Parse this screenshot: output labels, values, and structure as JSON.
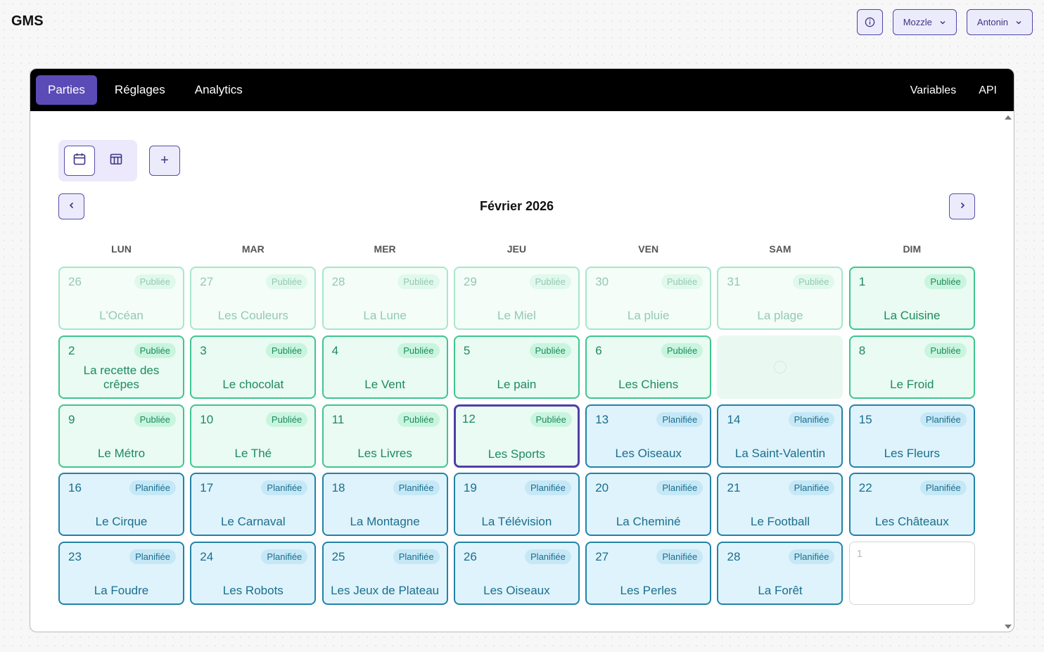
{
  "app": {
    "title": "GMS"
  },
  "topbar": {
    "info_icon": "info-icon",
    "org_selector": "Mozzle",
    "user_selector": "Antonin"
  },
  "nav": {
    "tabs": [
      "Parties",
      "Réglages",
      "Analytics"
    ],
    "active_tab": "Parties",
    "right_links": [
      "Variables",
      "API"
    ]
  },
  "toolbar": {
    "views": [
      "calendar-icon",
      "table-icon"
    ],
    "active_view": "calendar-icon",
    "add_label": "+"
  },
  "calendar": {
    "month": "Février 2026",
    "weekdays": [
      "LUN",
      "MAR",
      "MER",
      "JEU",
      "VEN",
      "SAM",
      "DIM"
    ],
    "status_colors": {
      "Publiée": "#3fc58f",
      "Planifiée": "#2283a8",
      "selected": "#4e3fa6"
    },
    "cells": [
      {
        "day": "26",
        "status": "Publiée",
        "title": "L'Océan",
        "variant": "faded"
      },
      {
        "day": "27",
        "status": "Publiée",
        "title": "Les Couleurs",
        "variant": "faded"
      },
      {
        "day": "28",
        "status": "Publiée",
        "title": "La Lune",
        "variant": "faded"
      },
      {
        "day": "29",
        "status": "Publiée",
        "title": "Le Miel",
        "variant": "faded"
      },
      {
        "day": "30",
        "status": "Publiée",
        "title": "La pluie",
        "variant": "faded"
      },
      {
        "day": "31",
        "status": "Publiée",
        "title": "La plage",
        "variant": "faded"
      },
      {
        "day": "1",
        "status": "Publiée",
        "title": "La Cuisine",
        "variant": "published"
      },
      {
        "day": "2",
        "status": "Publiée",
        "title": "La recette des crêpes",
        "variant": "published"
      },
      {
        "day": "3",
        "status": "Publiée",
        "title": "Le chocolat",
        "variant": "published"
      },
      {
        "day": "4",
        "status": "Publiée",
        "title": "Le Vent",
        "variant": "published"
      },
      {
        "day": "5",
        "status": "Publiée",
        "title": "Le pain",
        "variant": "published"
      },
      {
        "day": "6",
        "status": "Publiée",
        "title": "Les Chiens",
        "variant": "published"
      },
      {
        "day": "",
        "status": "",
        "title": "",
        "variant": "empty"
      },
      {
        "day": "8",
        "status": "Publiée",
        "title": "Le Froid",
        "variant": "published"
      },
      {
        "day": "9",
        "status": "Publiée",
        "title": "Le Métro",
        "variant": "published"
      },
      {
        "day": "10",
        "status": "Publiée",
        "title": "Le Thé",
        "variant": "published"
      },
      {
        "day": "11",
        "status": "Publiée",
        "title": "Les Livres",
        "variant": "published"
      },
      {
        "day": "12",
        "status": "Publiée",
        "title": "Les Sports",
        "variant": "selected"
      },
      {
        "day": "13",
        "status": "Planifiée",
        "title": "Les Oiseaux",
        "variant": "planned"
      },
      {
        "day": "14",
        "status": "Planifiée",
        "title": "La Saint-Valentin",
        "variant": "planned"
      },
      {
        "day": "15",
        "status": "Planifiée",
        "title": "Les Fleurs",
        "variant": "planned"
      },
      {
        "day": "16",
        "status": "Planifiée",
        "title": "Le Cirque",
        "variant": "planned"
      },
      {
        "day": "17",
        "status": "Planifiée",
        "title": "Le Carnaval",
        "variant": "planned"
      },
      {
        "day": "18",
        "status": "Planifiée",
        "title": "La Montagne",
        "variant": "planned"
      },
      {
        "day": "19",
        "status": "Planifiée",
        "title": "La Télévision",
        "variant": "planned"
      },
      {
        "day": "20",
        "status": "Planifiée",
        "title": "La Cheminé",
        "variant": "planned"
      },
      {
        "day": "21",
        "status": "Planifiée",
        "title": "Le Football",
        "variant": "planned"
      },
      {
        "day": "22",
        "status": "Planifiée",
        "title": "Les Châteaux",
        "variant": "planned"
      },
      {
        "day": "23",
        "status": "Planifiée",
        "title": "La Foudre",
        "variant": "planned"
      },
      {
        "day": "24",
        "status": "Planifiée",
        "title": "Les Robots",
        "variant": "planned"
      },
      {
        "day": "25",
        "status": "Planifiée",
        "title": "Les Jeux de Plateau",
        "variant": "planned"
      },
      {
        "day": "26",
        "status": "Planifiée",
        "title": "Les Oiseaux",
        "variant": "planned"
      },
      {
        "day": "27",
        "status": "Planifiée",
        "title": "Les Perles",
        "variant": "planned"
      },
      {
        "day": "28",
        "status": "Planifiée",
        "title": "La Forêt",
        "variant": "planned"
      },
      {
        "day": "1",
        "status": "",
        "title": "",
        "variant": "blank"
      }
    ]
  }
}
